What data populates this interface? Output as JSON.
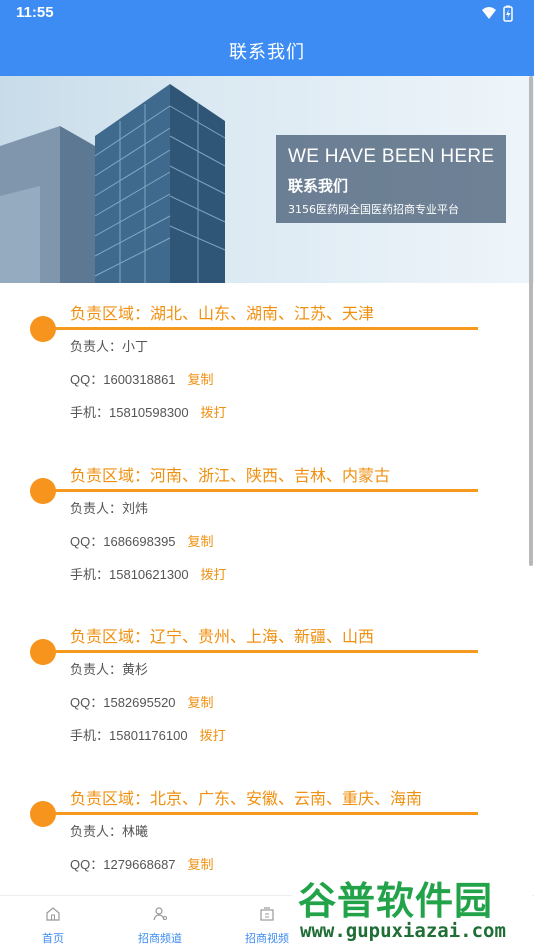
{
  "status": {
    "time": "11:55"
  },
  "header": {
    "title": "联系我们"
  },
  "banner": {
    "en_heading": "WE HAVE BEEN HERE",
    "cn_heading": "联系我们",
    "subtitle": "3156医药网全国医药招商专业平台"
  },
  "regions": [
    {
      "title": "负责区域：湖北、山东、湖南、江苏、天津",
      "person_label": "负责人：",
      "person": "小丁",
      "qq_label": "QQ：",
      "qq": "1600318861",
      "copy": "复制",
      "phone_label": "手机：",
      "phone": "15810598300",
      "call": "拨打"
    },
    {
      "title": "负责区域：河南、浙江、陕西、吉林、内蒙古",
      "person_label": "负责人：",
      "person": "刘炜",
      "qq_label": "QQ：",
      "qq": "1686698395",
      "copy": "复制",
      "phone_label": "手机：",
      "phone": "15810621300",
      "call": "拨打"
    },
    {
      "title": "负责区域：辽宁、贵州、上海、新疆、山西",
      "person_label": "负责人：",
      "person": "黄杉",
      "qq_label": "QQ：",
      "qq": "1582695520",
      "copy": "复制",
      "phone_label": "手机：",
      "phone": "15801176100",
      "call": "拨打"
    },
    {
      "title": "负责区域：北京、广东、安徽、云南、重庆、海南",
      "person_label": "负责人：",
      "person": "林曦",
      "qq_label": "QQ：",
      "qq": "1279668687",
      "copy": "复制"
    }
  ],
  "bottom_nav": [
    {
      "label": "首页",
      "icon": "home-icon"
    },
    {
      "label": "招商频道",
      "icon": "person-icon"
    },
    {
      "label": "招商视频",
      "icon": "video-icon"
    }
  ],
  "watermark": {
    "brand": "谷普软件园",
    "url": "www.gupuxiazai.com"
  },
  "colors": {
    "primary": "#3d8cf3",
    "accent": "#f09010",
    "text": "#555555"
  }
}
